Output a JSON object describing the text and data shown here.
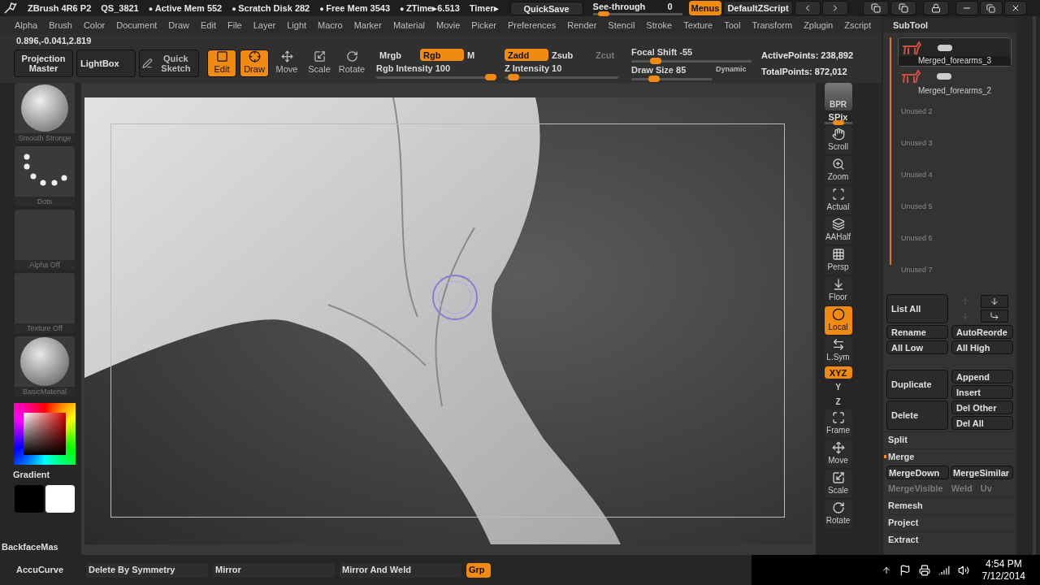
{
  "title_bar": {
    "app": "ZBrush 4R6 P2",
    "file": "QS_3821",
    "stats": [
      {
        "text": "Active Mem 552",
        "bullet": "●"
      },
      {
        "text": "Scratch Disk 282",
        "bullet": "●"
      },
      {
        "text": "Free Mem 3543",
        "bullet": "●"
      },
      {
        "text": "ZTime▸6.513",
        "bullet": "●"
      },
      {
        "text": "Timer▸"
      }
    ],
    "quicksave": "QuickSave",
    "see_through": {
      "label": "See-through",
      "value": "0",
      "level": 0.06
    },
    "menus": {
      "label": "Menus",
      "selected": true
    },
    "script": "DefaultZScript"
  },
  "menu": [
    "Alpha",
    "Brush",
    "Color",
    "Document",
    "Draw",
    "Edit",
    "File",
    "Layer",
    "Light",
    "Macro",
    "Marker",
    "Material",
    "Movie",
    "Picker",
    "Preferences",
    "Render",
    "Stencil",
    "Stroke",
    "Texture",
    "Tool",
    "Transform",
    "Zplugin",
    "Zscript"
  ],
  "coords": "0.896,-0.041,2.819",
  "shelf": {
    "panels": [
      "Projection Master",
      "LightBox"
    ],
    "tools": [
      {
        "label": "Quick Sketch",
        "kind": "sketch",
        "selected": false
      },
      {
        "label": "Edit",
        "kind": "edit",
        "selected": true
      },
      {
        "label": "Draw",
        "kind": "draw",
        "selected": true
      },
      {
        "label": "Move",
        "kind": "move",
        "selected": false
      },
      {
        "label": "Scale",
        "kind": "scale",
        "selected": false
      },
      {
        "label": "Rotate",
        "kind": "rotate",
        "selected": false
      }
    ],
    "color_modes": [
      {
        "label": "Mrgb",
        "selected": false
      },
      {
        "label": "Rgb",
        "selected": true
      },
      {
        "label": "M",
        "selected": false
      }
    ],
    "rgb_intensity": {
      "label": "Rgb Intensity 100",
      "level": 0.95
    },
    "z_modes": [
      {
        "label": "Zadd",
        "selected": true,
        "disabled": false
      },
      {
        "label": "Zsub",
        "selected": false,
        "disabled": false
      },
      {
        "label": "Zcut",
        "selected": false,
        "disabled": true
      }
    ],
    "z_intensity": {
      "label": "Z Intensity 10",
      "level": 0.08
    },
    "focal_shift": {
      "label": "Focal Shift -55",
      "level": 0.2
    },
    "draw_size": {
      "label": "Draw Size 85",
      "level": 0.28
    },
    "dynamic": "Dynamic",
    "active_points": "ActivePoints: 238,892",
    "total_points": "TotalPoints: 872,012"
  },
  "left_tray": {
    "tiles": [
      {
        "label": "Smooth Stronge",
        "kind": "brush"
      },
      {
        "label": "Dots",
        "kind": "stroke"
      },
      {
        "label": "Alpha Off",
        "kind": "empty"
      },
      {
        "label": "Texture Off",
        "kind": "empty"
      },
      {
        "label": "BasicMaterial",
        "kind": "material"
      }
    ],
    "gradient": "Gradient",
    "backface": "BackfaceMas"
  },
  "right_shelf": [
    {
      "label": "BPR",
      "kind": "bpr",
      "selected": false
    },
    {
      "label": "SPix",
      "kind": "spix",
      "selected": false,
      "level": 0.5
    },
    {
      "label": "Scroll",
      "kind": "hand",
      "selected": false
    },
    {
      "label": "Zoom",
      "kind": "zoom",
      "selected": false
    },
    {
      "label": "Actual",
      "kind": "actual",
      "selected": false
    },
    {
      "label": "AAHalf",
      "kind": "aahalf",
      "selected": false
    },
    {
      "label": "Persp",
      "kind": "persp",
      "selected": false
    },
    {
      "label": "Floor",
      "kind": "floor",
      "selected": false
    },
    {
      "label": "Local",
      "kind": "local",
      "selected": true
    },
    {
      "label": "L.Sym",
      "kind": "lsym",
      "selected": false
    },
    {
      "label": "XYZ",
      "kind": "xyz",
      "selected": true
    },
    {
      "label": "Y",
      "kind": "axis",
      "selected": false
    },
    {
      "label": "Z",
      "kind": "axis",
      "selected": false
    },
    {
      "label": "Frame",
      "kind": "frame",
      "selected": false
    },
    {
      "label": "Move",
      "kind": "move",
      "selected": false
    },
    {
      "label": "Scale",
      "kind": "scale",
      "selected": false
    },
    {
      "label": "Rotate",
      "kind": "rotate",
      "selected": false
    }
  ],
  "subtool": {
    "title": "SubTool",
    "items": [
      {
        "name": "Merged_forearms_3",
        "selected": true
      },
      {
        "name": "Merged_forearms_2",
        "selected": false
      }
    ],
    "unused": [
      "Unused 2",
      "Unused 3",
      "Unused 4",
      "Unused 5",
      "Unused 6",
      "Unused 7"
    ],
    "list_all": "List All",
    "rename": "Rename",
    "auto_reorder": "AutoReorde",
    "all_low": "All Low",
    "all_high": "All High",
    "duplicate": "Duplicate",
    "append": "Append",
    "insert": "Insert",
    "delete": "Delete",
    "del_other": "Del Other",
    "del_all": "Del All",
    "split": {
      "label": "Split",
      "expanded": false
    },
    "merge": {
      "label": "Merge",
      "expanded": true
    },
    "merge_buttons": [
      {
        "label": "MergeDown",
        "disabled": false
      },
      {
        "label": "MergeSimilar",
        "disabled": false
      },
      {
        "label": "MergeVisible",
        "disabled": true
      },
      {
        "label": "Weld",
        "disabled": true
      },
      {
        "label": "Uv",
        "disabled": true
      }
    ],
    "sections": [
      "Remesh",
      "Project",
      "Extract"
    ]
  },
  "bottom_bar": {
    "accucurve": "AccuCurve",
    "buttons": [
      {
        "label": "Delete By Symmetry",
        "selected": false
      },
      {
        "label": "Mirror",
        "selected": false
      },
      {
        "label": "Mirror And Weld",
        "selected": false
      },
      {
        "label": "Grp",
        "selected": true
      }
    ]
  },
  "taskbar": {
    "time": "4:54 PM",
    "date": "7/12/2014"
  }
}
